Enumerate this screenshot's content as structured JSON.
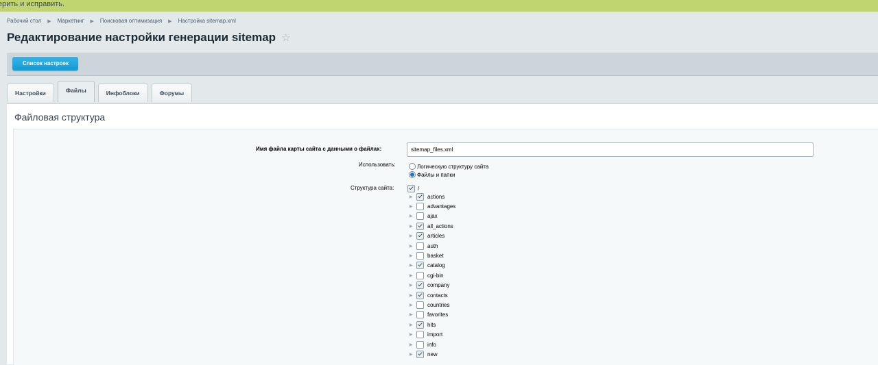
{
  "notice": {
    "text": "ерить и исправить."
  },
  "breadcrumb": [
    "Рабочий стол",
    "Маркетинг",
    "Поисковая оптимизация",
    "Настройка sitemap.xml"
  ],
  "page_title": "Редактирование настройки генерации sitemap",
  "toolbar": {
    "list_button": "Список настроек"
  },
  "tabs": [
    {
      "label": "Настройки",
      "active": false
    },
    {
      "label": "Файлы",
      "active": true
    },
    {
      "label": "Инфоблоки",
      "active": false
    },
    {
      "label": "Форумы",
      "active": false
    }
  ],
  "section_title": "Файловая структура",
  "form": {
    "filename_label": "Имя файла карты сайта с данными о файлах:",
    "filename_value": "sitemap_files.xml",
    "use_label": "Использовать:",
    "use_options": [
      {
        "label": "Логическую структуру сайта",
        "selected": false
      },
      {
        "label": "Файлы и папки",
        "selected": true
      }
    ],
    "structure_label": "Структура сайта:",
    "root": {
      "label": "/",
      "checked": true
    },
    "tree": [
      {
        "label": "actions",
        "checked": true
      },
      {
        "label": "advantages",
        "checked": false
      },
      {
        "label": "ajax",
        "checked": false
      },
      {
        "label": "all_actions",
        "checked": true
      },
      {
        "label": "articles",
        "checked": true
      },
      {
        "label": "auth",
        "checked": false
      },
      {
        "label": "basket",
        "checked": false
      },
      {
        "label": "catalog",
        "checked": true
      },
      {
        "label": "cgi-bin",
        "checked": false
      },
      {
        "label": "company",
        "checked": true
      },
      {
        "label": "contacts",
        "checked": true
      },
      {
        "label": "countries",
        "checked": false
      },
      {
        "label": "favorites",
        "checked": false
      },
      {
        "label": "hits",
        "checked": true
      },
      {
        "label": "import",
        "checked": false
      },
      {
        "label": "info",
        "checked": false
      },
      {
        "label": "new",
        "checked": true
      }
    ]
  },
  "colors": {
    "top_bar": "#c0d470",
    "accent_button": "#1ea8de",
    "radio_selected": "#1b72d8"
  }
}
